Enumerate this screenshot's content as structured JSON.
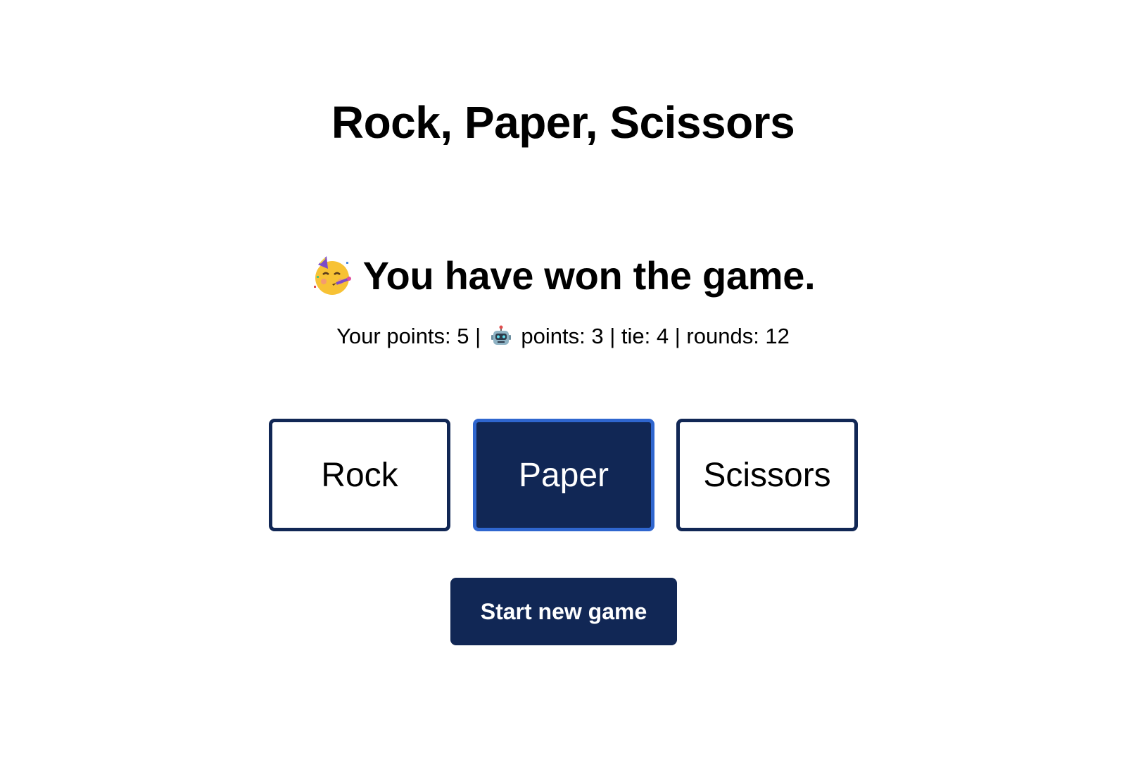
{
  "title": "Rock, Paper, Scissors",
  "result": {
    "emoji_icon": "party-face-icon",
    "text": "You have won the game."
  },
  "score": {
    "your_label": "Your points: ",
    "your_points": "5",
    "separator": " | ",
    "bot_icon": "robot-icon",
    "bot_label": " points: ",
    "bot_points": "3",
    "tie_label": "tie: ",
    "tie_value": "4",
    "rounds_label": "rounds: ",
    "rounds_value": "12"
  },
  "choices": [
    {
      "label": "Rock",
      "selected": false
    },
    {
      "label": "Paper",
      "selected": true
    },
    {
      "label": "Scissors",
      "selected": false
    }
  ],
  "new_game_label": "Start new game",
  "colors": {
    "primary": "#112755",
    "selected_border": "#2f66cf",
    "background": "#ffffff"
  }
}
